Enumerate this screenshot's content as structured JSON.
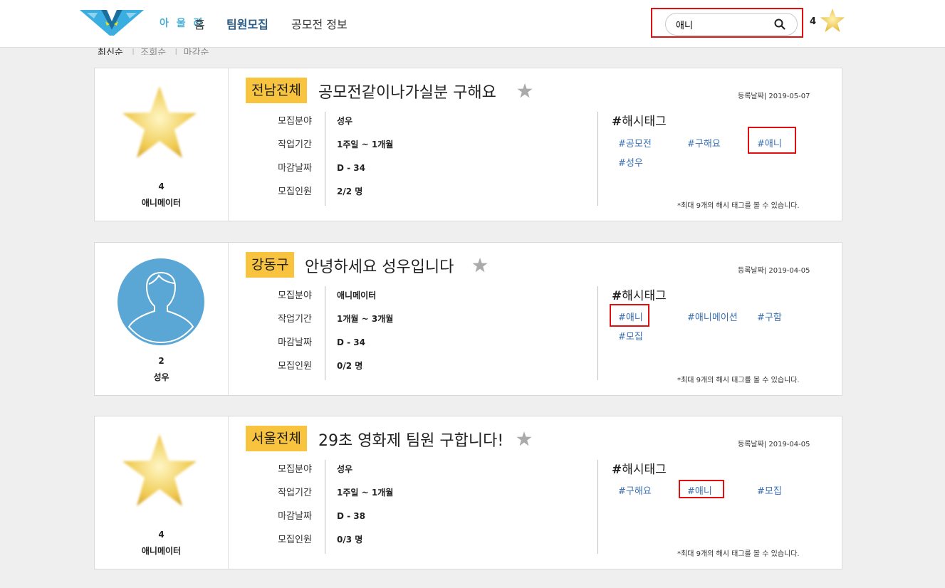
{
  "header": {
    "logo_text": "아 울 러",
    "nav": {
      "home": "홈",
      "team": "팀원모집",
      "contest": "공모전 정보"
    },
    "search_value": "애니",
    "user_count": "4"
  },
  "sort": {
    "latest": "최신순",
    "views": "조회순",
    "deadline": "마감순"
  },
  "labels": {
    "field": "모집분야",
    "period": "작업기간",
    "deadline": "마감날짜",
    "members": "모집인원",
    "hashtitle": "해시태그",
    "hash_prefix": "#",
    "regdate": "등록날짜|",
    "note": "*최대 9개의 해시 태그를 볼 수 있습니다."
  },
  "cards": [
    {
      "region": "전남전체",
      "title": "공모전같이나가실분 구해요",
      "regdate": "2019-05-07",
      "field": "성우",
      "period": "1주일 ~ 1개월",
      "deadline": "D - 34",
      "members": "2/2  명",
      "writer_count": "4",
      "writer_field": "애니메이터",
      "tags": [
        "#공모전",
        "#구해요",
        "#애니",
        "#성우"
      ]
    },
    {
      "region": "강동구",
      "title": "안녕하세요 성우입니다",
      "regdate": "2019-04-05",
      "field": "애니메이터",
      "period": "1개월 ~ 3개월",
      "deadline": "D - 34",
      "members": "0/2  명",
      "writer_count": "2",
      "writer_field": "성우",
      "tags": [
        "#애니",
        "#애니메이션",
        "#구함",
        "#모집"
      ]
    },
    {
      "region": "서울전체",
      "title": "29초 영화제 팀원 구합니다!",
      "regdate": "2019-04-05",
      "field": "성우",
      "period": "1주일 ~ 1개월",
      "deadline": "D - 38",
      "members": "0/3  명",
      "writer_count": "4",
      "writer_field": "애니메이터",
      "tags": [
        "#구해요",
        "#애니",
        "#모집"
      ]
    }
  ],
  "colors": {
    "accent": "#f8c440",
    "tag": "#3a71b5",
    "highlight": "#e01010",
    "avatar_bg": "#5aa7d6"
  }
}
